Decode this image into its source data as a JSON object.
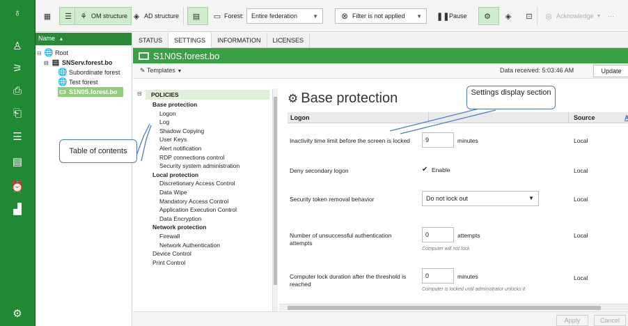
{
  "toolbar": {
    "om_structure": "OM structure",
    "ad_structure": "AD structure",
    "forest_label": "Forest:",
    "forest_value": "Entire federation",
    "filter_label": "Filter is not applied",
    "pause": "Pause",
    "acknowledge": "Acknowledge",
    "more": "···"
  },
  "tree": {
    "header": "Name",
    "header_sort": "▲",
    "root": "Root",
    "server": "SNServ.forest.bo",
    "subordinate": "Subordinate forest",
    "test_forest": "Test forest",
    "selected_host": "S1N0S.forest.bo"
  },
  "tabs": [
    "STATUS",
    "SETTINGS",
    "INFORMATION",
    "LICENSES"
  ],
  "host_title": "S1N0S.forest.bo",
  "subbar": {
    "templates": "Templates",
    "data_received_label": "Data received:",
    "data_received_time": "5:03:46 AM",
    "update": "Update"
  },
  "toc": {
    "policies": "POLICIES",
    "items": [
      {
        "label": "Base protection",
        "bold": true,
        "indent": 0
      },
      {
        "label": "Logon",
        "bold": false,
        "indent": 1
      },
      {
        "label": "Log",
        "bold": false,
        "indent": 1
      },
      {
        "label": "Shadow Copying",
        "bold": false,
        "indent": 1
      },
      {
        "label": "User Keys",
        "bold": false,
        "indent": 1
      },
      {
        "label": "Alert notification",
        "bold": false,
        "indent": 1
      },
      {
        "label": "RDP connections control",
        "bold": false,
        "indent": 1
      },
      {
        "label": "Security system administration",
        "bold": false,
        "indent": 1
      },
      {
        "label": "Local protection",
        "bold": true,
        "indent": 0
      },
      {
        "label": "Discretionary Access Control",
        "bold": false,
        "indent": 1
      },
      {
        "label": "Data Wipe",
        "bold": false,
        "indent": 1
      },
      {
        "label": "Mandatory Access Control",
        "bold": false,
        "indent": 1
      },
      {
        "label": "Application Execution Control",
        "bold": false,
        "indent": 1
      },
      {
        "label": "Data Encryption",
        "bold": false,
        "indent": 1
      },
      {
        "label": "Network protection",
        "bold": true,
        "indent": 0
      },
      {
        "label": "Firewall",
        "bold": false,
        "indent": 1
      },
      {
        "label": "Network Authentication",
        "bold": false,
        "indent": 1
      },
      {
        "label": "Device Control",
        "bold": false,
        "indent": 0
      },
      {
        "label": "Print Control",
        "bold": false,
        "indent": 0
      }
    ]
  },
  "section": {
    "title": "Base protection",
    "col_setting": "Logon",
    "col_source": "Source",
    "col_extra": "A",
    "rows": {
      "inactivity": {
        "label": "Inactivity time limit before the screen is locked",
        "value": "9",
        "unit": "minutes",
        "source": "Local"
      },
      "deny": {
        "label": "Deny secondary logon",
        "check": "✔",
        "value": "Enable",
        "source": "Local"
      },
      "token": {
        "label": "Security token removal behavior",
        "value": "Do not lock out",
        "source": "Local"
      },
      "attempts": {
        "label": "Number of unsuccessful authentication attempts",
        "value": "0",
        "unit": "attempts",
        "hint": "Computer will not lock",
        "source": "Local"
      },
      "lockdur": {
        "label": "Computer lock duration after the threshold is reached",
        "value": "0",
        "unit": "minutes",
        "hint": "Computer is locked until administrator unlocks it",
        "source": "Local"
      }
    }
  },
  "footer": {
    "apply": "Apply",
    "cancel": "Cancel"
  },
  "callouts": {
    "toc": "Table of contents",
    "settings": "Settings display section"
  },
  "colors": {
    "brand_green": "#1f8a33",
    "header_green": "#3aa044",
    "selection": "#8ed07a",
    "callout_border": "#4a78c8"
  }
}
